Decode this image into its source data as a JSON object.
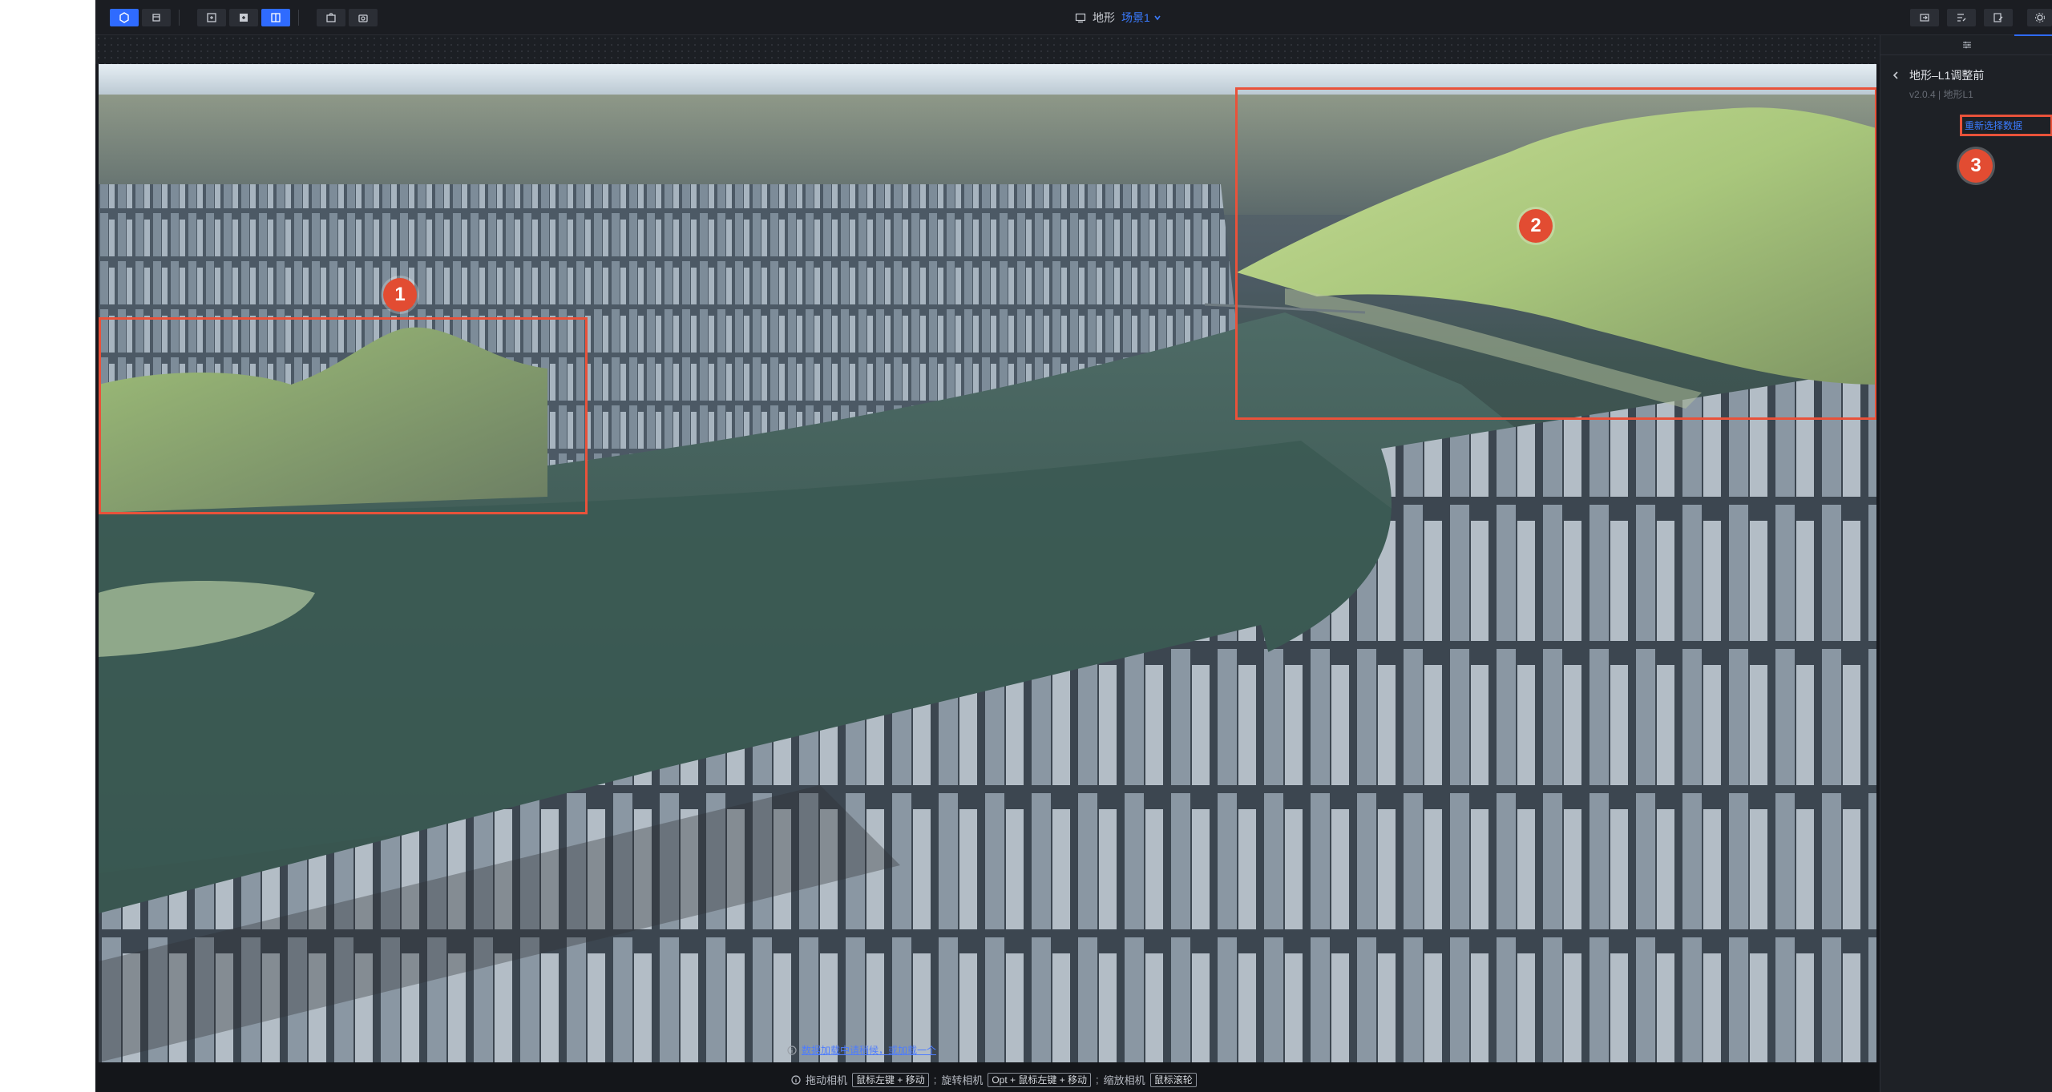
{
  "toolbar": {
    "left_icons": [
      "select-icon",
      "hand-icon",
      "layer-icon",
      "add-layer-icon",
      "split-view-icon",
      "capture-icon",
      "camera-icon"
    ],
    "right_icons": [
      "export-icon",
      "list-edit-icon",
      "edit-doc-icon",
      "settings-icon"
    ]
  },
  "scene": {
    "type_label": "地形",
    "scene_name": "场景1"
  },
  "panel": {
    "filter_icon": "sliders-icon",
    "title": "地形–L1调整前",
    "subtitle": "v2.0.4 | 地形L1",
    "reselect_label": "重新选择数据"
  },
  "annotations": [
    {
      "number": "1",
      "label": "left-hill-region"
    },
    {
      "number": "2",
      "label": "right-mountain-region"
    },
    {
      "number": "3",
      "label": "reselect-data-button"
    }
  ],
  "hints": {
    "warning": "数据加载中请稍候，或加载一个",
    "pan_label": "拖动相机",
    "pan_keys": "鼠标左键 + 移动",
    "rotate_label": "旋转相机",
    "rotate_keys": "Opt + 鼠标左键 + 移动",
    "zoom_label": "缩放相机",
    "zoom_keys": "鼠标滚轮"
  },
  "colors": {
    "accent": "#2f6bff",
    "annotation": "#e9523a",
    "water": "#3b5a53",
    "terrain": "#a8c77c"
  }
}
